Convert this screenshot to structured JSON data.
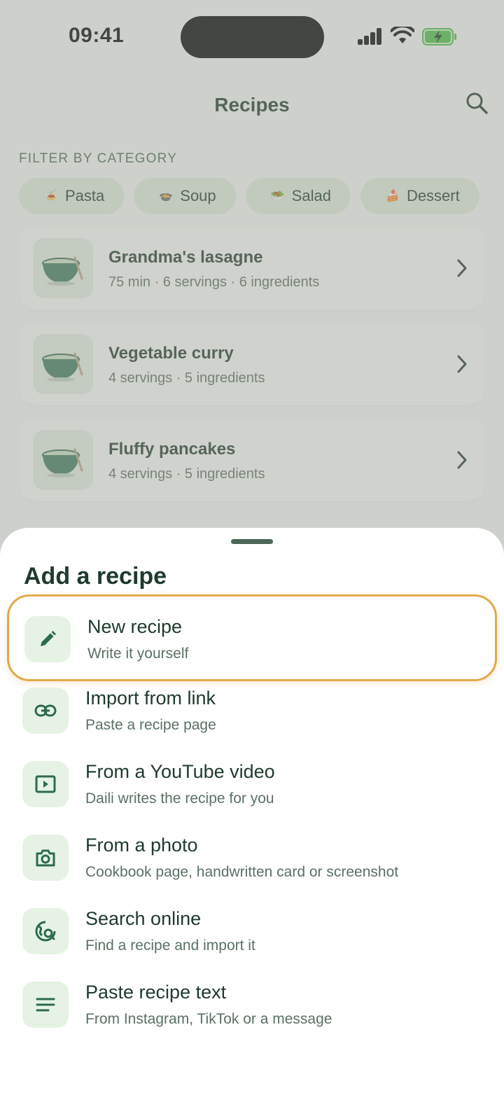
{
  "status": {
    "time": "09:41"
  },
  "header": {
    "title": "Recipes"
  },
  "filter": {
    "label": "FILTER BY CATEGORY",
    "chips": [
      {
        "emoji": "🍝",
        "label": "Pasta"
      },
      {
        "emoji": "🍲",
        "label": "Soup"
      },
      {
        "emoji": "🥗",
        "label": "Salad"
      },
      {
        "emoji": "🍰",
        "label": "Dessert"
      }
    ]
  },
  "recipes": [
    {
      "title": "Grandma's lasagne",
      "meta": "75 min · 6 servings · 6 ingredients"
    },
    {
      "title": "Vegetable curry",
      "meta": "4 servings · 5 ingredients"
    },
    {
      "title": "Fluffy pancakes",
      "meta": "4 servings · 5 ingredients"
    }
  ],
  "sheet": {
    "title": "Add a recipe",
    "options": [
      {
        "icon": "pencil-icon",
        "title": "New recipe",
        "subtitle": "Write it yourself",
        "highlighted": true
      },
      {
        "icon": "link-icon",
        "title": "Import from link",
        "subtitle": "Paste a recipe page"
      },
      {
        "icon": "video-play-icon",
        "title": "From a YouTube video",
        "subtitle": "Daili writes the recipe for you"
      },
      {
        "icon": "camera-icon",
        "title": "From a photo",
        "subtitle": "Cookbook page, handwritten card or screenshot"
      },
      {
        "icon": "globe-search-icon",
        "title": "Search online",
        "subtitle": "Find a recipe and import it"
      },
      {
        "icon": "text-lines-icon",
        "title": "Paste recipe text",
        "subtitle": "From Instagram, TikTok or a message"
      }
    ]
  },
  "colors": {
    "primary": "#2d6a4f",
    "icon_bg": "#e6f3e4",
    "highlight_border": "#e2a94a",
    "text": "#1f3a2c"
  }
}
